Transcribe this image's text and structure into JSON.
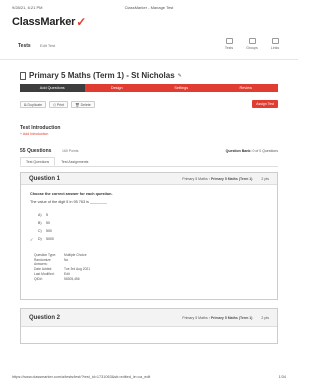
{
  "print_header": {
    "datetime": "9/28/21, 6:21 PM",
    "title": "ClassMarker - Manage Test"
  },
  "logo": {
    "text": "ClassMarker",
    "mark": "✓"
  },
  "nav": {
    "section": "Tests",
    "edit": "Edit Test",
    "tools": [
      {
        "label": "Tests",
        "icon": "tests-icon"
      },
      {
        "label": "Groups",
        "icon": "groups-icon"
      },
      {
        "label": "Links",
        "icon": "links-icon"
      }
    ]
  },
  "test": {
    "title": "Primary 5 Maths (Term 1) - St Nicholas"
  },
  "steps": [
    {
      "label": "Add Questions"
    },
    {
      "label": "Design"
    },
    {
      "label": "Settings"
    },
    {
      "label": "Review"
    }
  ],
  "actions": {
    "duplicate": "Duplicate",
    "print": "Print",
    "delete": "Delete",
    "assign": "Assign Test"
  },
  "intro": {
    "title": "Test Introduction",
    "link": "+ Add Introduction"
  },
  "questions_summary": {
    "count": "55 Questions",
    "points": "160 Points",
    "bank_label": "Question Bank:",
    "bank_value": "0 of 0 Questions"
  },
  "tabs": [
    {
      "label": "Test Questions"
    },
    {
      "label": "Test Assignments"
    }
  ],
  "question1": {
    "title": "Question 1",
    "category": "Primary 5 Maths",
    "test": "Primary 5 Maths (Term 1)",
    "points": "2 pts",
    "instruction": "Choose the correct answer for each question.",
    "stem": "The value of the digit 5 in 95 763 is ________",
    "options": [
      {
        "letter": "A)",
        "text": "5"
      },
      {
        "letter": "B)",
        "text": "50"
      },
      {
        "letter": "C)",
        "text": "500"
      },
      {
        "letter": "D)",
        "text": "5000"
      }
    ],
    "info": [
      {
        "k": "Question Type:",
        "v": "Multiple Choice"
      },
      {
        "k": "Randomize Answers:",
        "v": "No"
      },
      {
        "k": "Date Added:",
        "v": "Tue 3rd Aug 2021"
      },
      {
        "k": "Last Modified:",
        "v": "Edit"
      },
      {
        "k": "QID#:",
        "v": "56305,456"
      }
    ]
  },
  "question2": {
    "title": "Question 2",
    "category": "Primary 5 Maths",
    "test": "Primary 5 Maths (Term 1)",
    "points": "2 pts"
  },
  "print_footer": {
    "url": "https://www.classmarker.com/a/tests/test/?test_id=1731063&sb=edited_ie=ca_edit",
    "page": "1/34"
  },
  "colors": {
    "accent": "#e03c31",
    "dark": "#3d3d3d"
  }
}
